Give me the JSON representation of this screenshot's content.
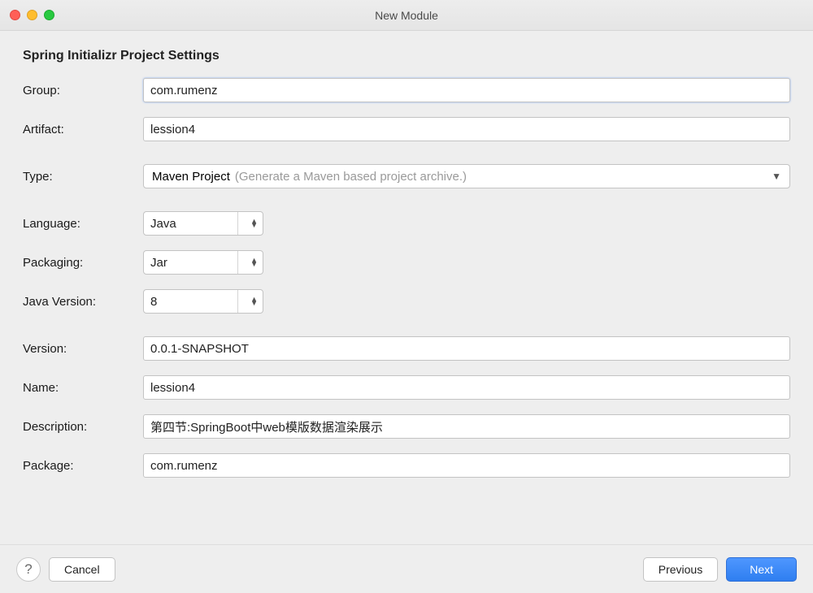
{
  "window": {
    "title": "New Module"
  },
  "heading": "Spring Initializr Project Settings",
  "labels": {
    "group": "Group:",
    "artifact": "Artifact:",
    "type": "Type:",
    "language": "Language:",
    "packaging": "Packaging:",
    "java_version": "Java Version:",
    "version": "Version:",
    "name": "Name:",
    "description": "Description:",
    "package": "Package:"
  },
  "values": {
    "group": "com.rumenz",
    "artifact": "lession4",
    "type": "Maven Project",
    "type_hint": "(Generate a Maven based project archive.)",
    "language": "Java",
    "packaging": "Jar",
    "java_version": "8",
    "version": "0.0.1-SNAPSHOT",
    "name": "lession4",
    "description": "第四节:SpringBoot中web模版数据渲染展示",
    "package": "com.rumenz"
  },
  "buttons": {
    "cancel": "Cancel",
    "previous": "Previous",
    "next": "Next",
    "help": "?"
  }
}
